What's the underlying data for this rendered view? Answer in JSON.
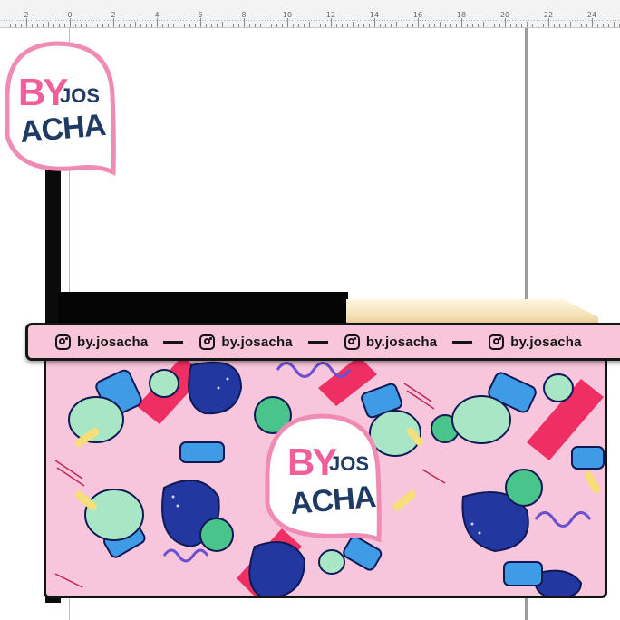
{
  "ruler": {
    "labels": [
      "2",
      "0",
      "2",
      "4",
      "6",
      "8",
      "10",
      "12",
      "14",
      "16",
      "18",
      "20",
      "22",
      "24"
    ]
  },
  "brand": {
    "by": "BY",
    "jos": "JOS",
    "acha": "ACHA"
  },
  "band": {
    "handles": [
      "by.josacha",
      "by.josacha",
      "by.josacha",
      "by.josacha"
    ]
  },
  "icons": {
    "handle_icon": "instagram-icon"
  },
  "colors": {
    "brand_pink": "#ef5f9a",
    "brand_navy": "#1f3a64",
    "cart_pink": "#f7c6dc",
    "frame_black": "#141414"
  }
}
